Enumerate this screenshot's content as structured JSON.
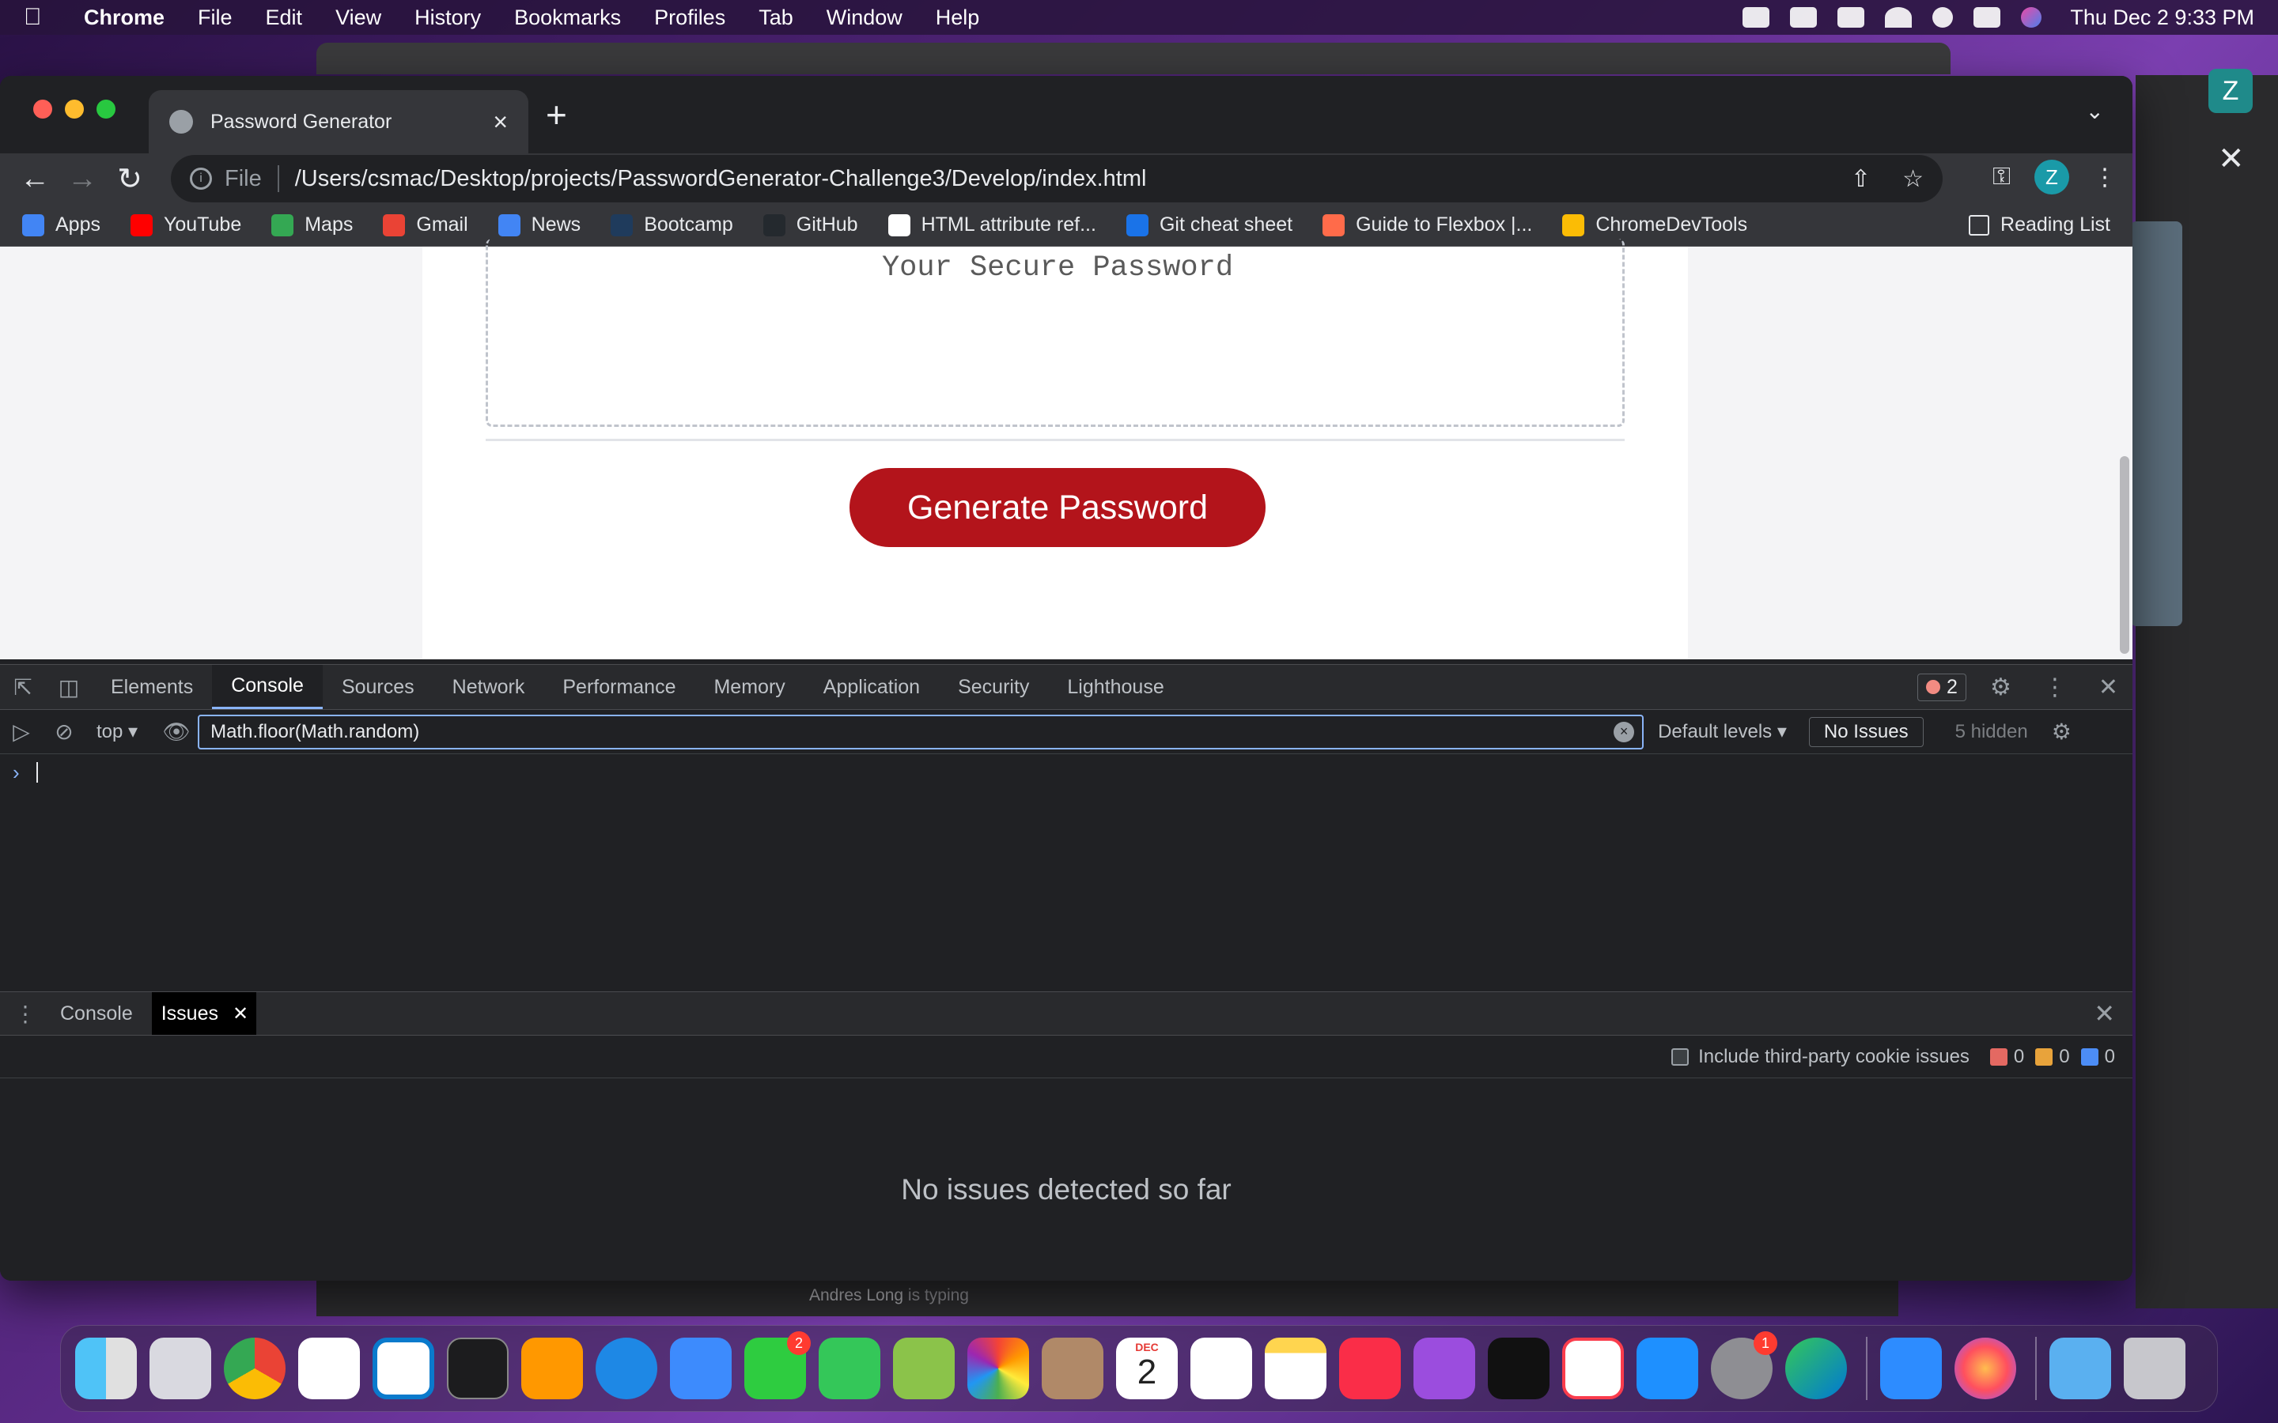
{
  "menubar": {
    "app": "Chrome",
    "items": [
      "File",
      "Edit",
      "View",
      "History",
      "Bookmarks",
      "Profiles",
      "Tab",
      "Window",
      "Help"
    ],
    "clock": "Thu Dec 2  9:33 PM"
  },
  "background": {
    "typing_name": "Andres Long",
    "typing_text": " is typing",
    "avatar_letter": "Z"
  },
  "browser": {
    "tab_title": "Password Generator",
    "url_scheme": "File",
    "url": "/Users/csmac/Desktop/projects/PasswordGenerator-Challenge3/Develop/index.html",
    "profile_letter": "Z",
    "bookmarks": [
      {
        "label": "Apps",
        "color": "#4285f4"
      },
      {
        "label": "YouTube",
        "color": "#ff0000"
      },
      {
        "label": "Maps",
        "color": "#34a853"
      },
      {
        "label": "Gmail",
        "color": "#ea4335"
      },
      {
        "label": "News",
        "color": "#4285f4"
      },
      {
        "label": "Bootcamp",
        "color": "#1f3b5c"
      },
      {
        "label": "GitHub",
        "color": "#24292e"
      },
      {
        "label": "HTML attribute ref...",
        "color": "#ffffff"
      },
      {
        "label": "Git cheat sheet",
        "color": "#1a73e8"
      },
      {
        "label": "Guide to Flexbox |...",
        "color": "#ff6b4a"
      },
      {
        "label": "ChromeDevTools",
        "color": "#fbbc05"
      }
    ],
    "reading_list": "Reading List"
  },
  "page": {
    "password_placeholder": "Your Secure Password",
    "generate_button": "Generate Password",
    "button_color": "#b3141b"
  },
  "devtools": {
    "tabs": [
      "Elements",
      "Console",
      "Sources",
      "Network",
      "Performance",
      "Memory",
      "Application",
      "Security",
      "Lighthouse"
    ],
    "active_tab": "Console",
    "error_count": "2",
    "context": "top",
    "filter_value": "Math.floor(Math.random)",
    "levels": "Default levels",
    "no_issues": "No Issues",
    "hidden": "5 hidden",
    "drawer": {
      "tabs": [
        "Console",
        "Issues"
      ],
      "active": "Issues",
      "include_label": "Include third-party cookie issues",
      "errors": "0",
      "warnings": "0",
      "infos": "0",
      "empty_message": "No issues detected so far"
    }
  },
  "dock": {
    "facetime_badge": "2",
    "calendar_month": "DEC",
    "calendar_day": "2",
    "settings_badge": "1"
  }
}
